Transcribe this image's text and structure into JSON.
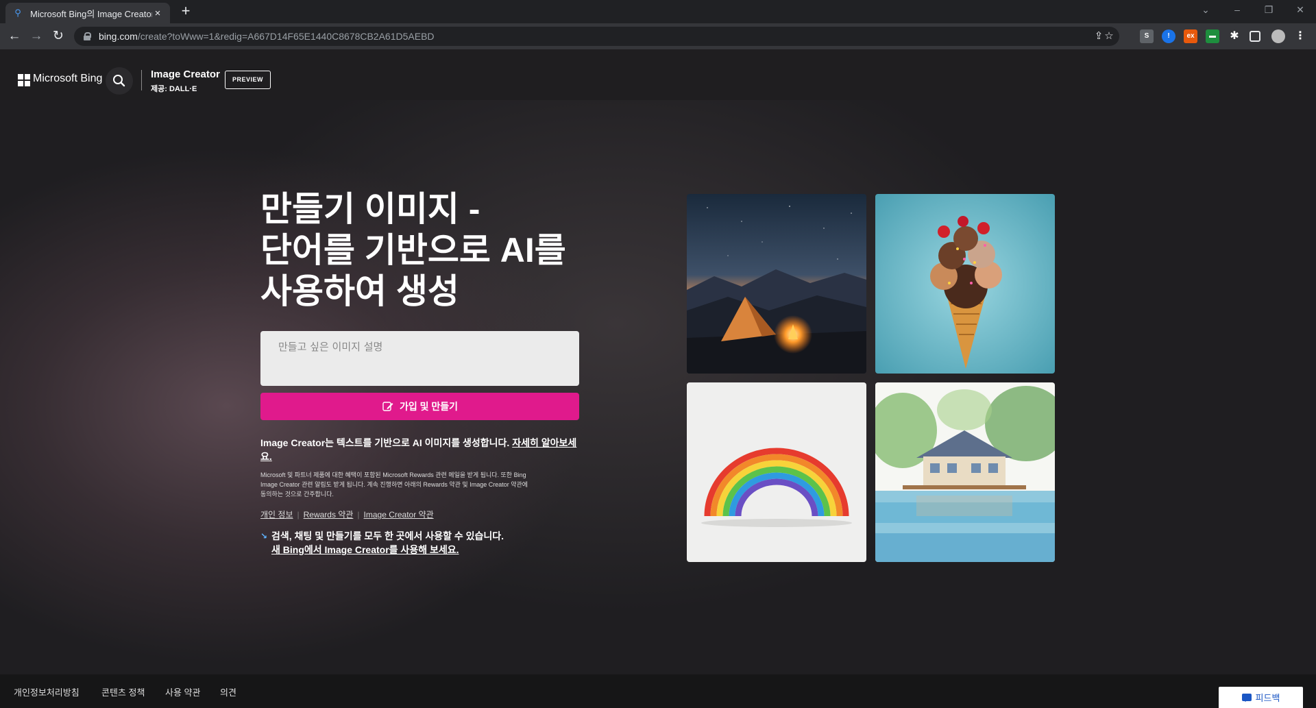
{
  "browser": {
    "tab_title": "Microsoft Bing의 Image Creator",
    "tab_favicon": "bing-search-icon",
    "url_host": "bing.com",
    "url_path": "/create?toWww=1&redig=A667D14F65E1440C8678CB2A61D5AEBD",
    "new_tab": "+",
    "window_controls": [
      "⌄",
      "–",
      "❐",
      "✕"
    ]
  },
  "header": {
    "brand": "Microsoft Bing",
    "product_title": "Image Creator",
    "product_sub": "제공: DALL·E",
    "preview_badge": "PREVIEW"
  },
  "hero": {
    "headline_line1": "만들기 이미지 -",
    "headline_line2": "단어를 기반으로 AI를",
    "headline_line3": "사용하여 생성",
    "prompt_placeholder": "만들고 싶은 이미지 설명",
    "create_button": "가입 및 만들기",
    "desc_text": "Image Creator는 텍스트를 기반으로 AI 이미지를 생성합니다. ",
    "desc_link": "자세히 알아보세요.",
    "fine_print": "Microsoft 및 파트너 제품에 대한 혜택이 포함된 Microsoft Rewards 관련 메일을 받게 됩니다. 또한 Bing Image Creator 관련 알림도 받게 됩니다. 계속 진행하면 아래의 Rewards 약관 및 Image Creator 약관에 동의하는 것으로 간주합니다.",
    "links": [
      "개인 정보",
      "Rewards 약관",
      "Image Creator 약관"
    ],
    "new_bing_line1": "검색, 채팅 및 만들기를 모두 한 곳에서 사용할 수 있습니다.",
    "new_bing_line2": "새 Bing에서 Image Creator를 사용해 보세요."
  },
  "footer": {
    "links": [
      "개인정보처리방침",
      "콘텐츠 정책",
      "사용 약관",
      "의견"
    ],
    "feedback": "피드백"
  },
  "colors": {
    "accent": "#e01a8c",
    "page_bg": "#1f1e21"
  }
}
